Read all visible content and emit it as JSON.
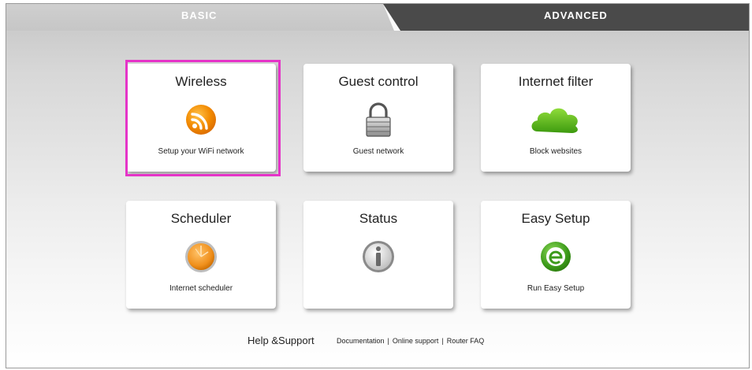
{
  "tabs": [
    {
      "label": "BASIC",
      "active": true
    },
    {
      "label": "ADVANCED",
      "active": false
    }
  ],
  "tiles": [
    {
      "title": "Wireless",
      "subtitle": "Setup your WiFi network",
      "icon": "wifi-signal-icon",
      "selected": true
    },
    {
      "title": "Guest control",
      "subtitle": "Guest network",
      "icon": "padlock-icon"
    },
    {
      "title": "Internet filter",
      "subtitle": "Block websites",
      "icon": "cloud-icon"
    },
    {
      "title": "Scheduler",
      "subtitle": "Internet scheduler",
      "icon": "clock-icon"
    },
    {
      "title": "Status",
      "subtitle": "",
      "icon": "info-icon"
    },
    {
      "title": "Easy Setup",
      "subtitle": "Run Easy Setup",
      "icon": "easy-setup-e-icon"
    }
  ],
  "footer": {
    "help_label": "Help &Support",
    "links": [
      "Documentation",
      "Online support",
      "Router FAQ"
    ],
    "separator": "|"
  },
  "colors": {
    "selection_outline": "#e534c8",
    "advanced_tab": "#4a4a4a",
    "wifi_orange": "#f08a00",
    "cloud_green": "#5ab814",
    "easy_setup_green": "#3c9a1a"
  }
}
